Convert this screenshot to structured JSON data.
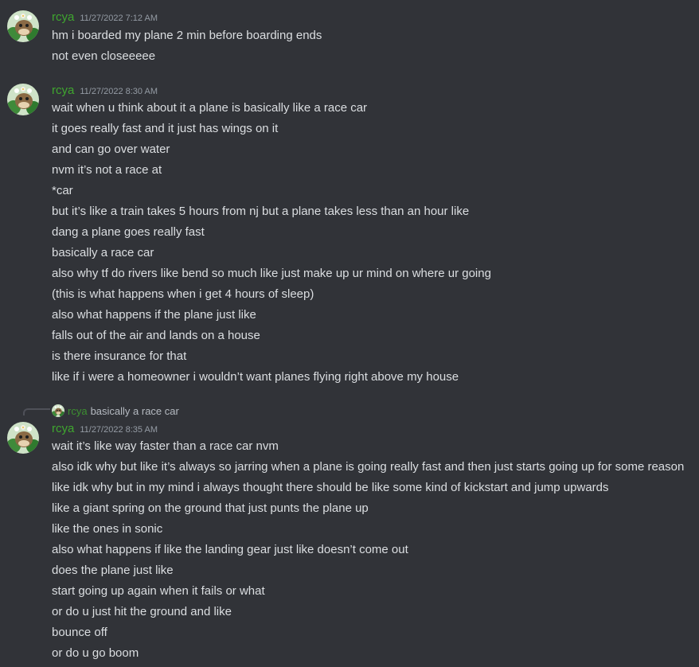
{
  "colors": {
    "background": "#313338",
    "username": "#3fa62f",
    "text": "#dbdee1",
    "timestamp": "#949ba4"
  },
  "groups": [
    {
      "username": "rcya",
      "timestamp": "11/27/2022 7:12 AM",
      "avatar_icon": "frog-avatar-icon",
      "messages": [
        "hm i boarded my plane 2 min before boarding ends",
        "not even closeeeee"
      ]
    },
    {
      "username": "rcya",
      "timestamp": "11/27/2022 8:30 AM",
      "avatar_icon": "frog-avatar-icon",
      "messages": [
        "wait when u think about it a plane is basically like a race car",
        "it goes really fast and it just has wings on it",
        "and can go over water",
        "nvm it’s not a race at",
        "*car",
        "but it’s like a train takes 5 hours from nj but a plane takes less than an hour like",
        "dang a plane goes really fast",
        "basically a race car",
        "also why tf do rivers like bend so much like just make up ur mind on where ur going",
        "(this is what happens when i get 4 hours of sleep)",
        "also what happens if the plane just like",
        "falls out of the air and lands on a house",
        "is there insurance for that",
        "like if i were a homeowner i wouldn’t want planes flying right above my house"
      ]
    },
    {
      "username": "rcya",
      "timestamp": "11/27/2022 8:35 AM",
      "avatar_icon": "frog-avatar-icon",
      "reply": {
        "username": "rcya",
        "text": "basically a race car"
      },
      "messages": [
        "wait it’s like way faster than a race car nvm",
        "also idk why but like it’s always so jarring when a plane is going really fast and then just starts going up for some reason",
        "like idk why but in my mind i always thought there should be like some kind of kickstart and jump upwards",
        "like a giant spring on the ground that just punts the plane up",
        "like the ones in sonic",
        "also what happens if like the landing gear just like doesn’t come out",
        "does the plane just like",
        "start going up again when it fails or what",
        "or do u just hit the ground and like",
        "bounce off",
        "or do u go boom"
      ]
    }
  ]
}
